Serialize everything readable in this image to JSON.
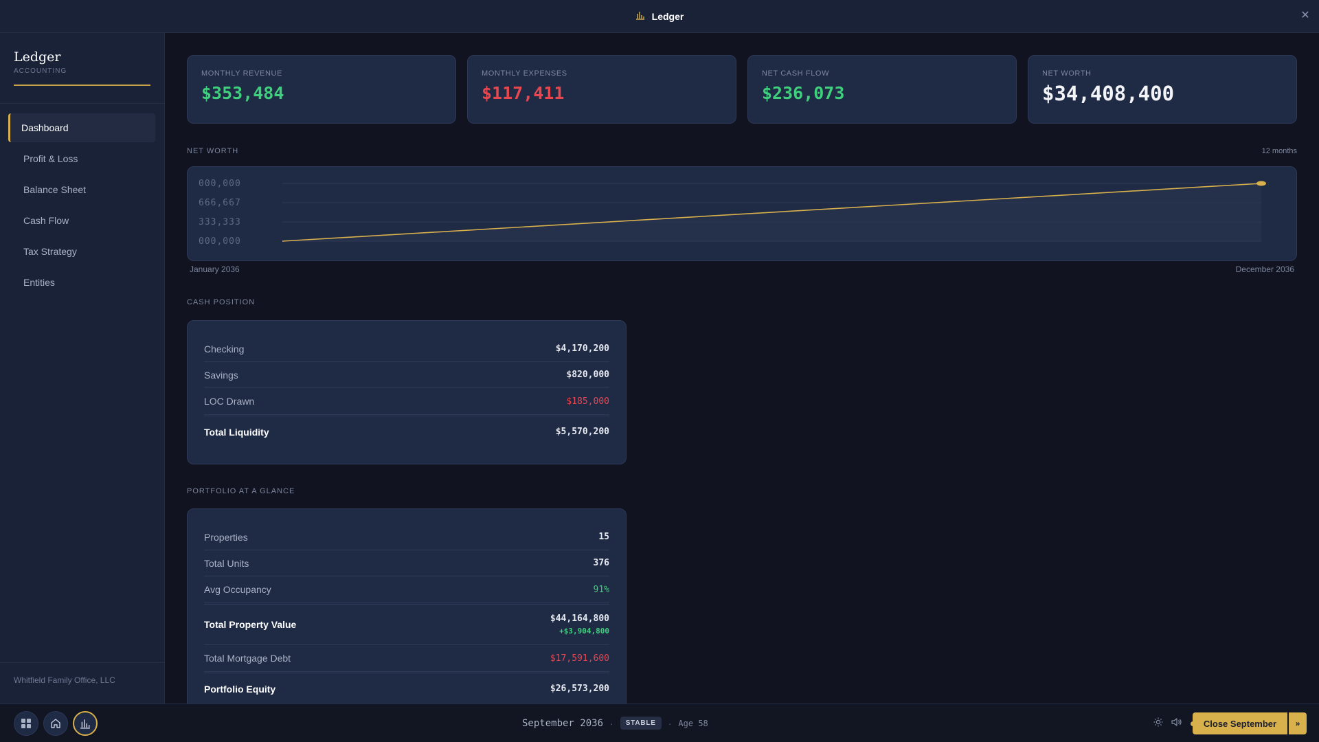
{
  "window": {
    "title": "Ledger",
    "close_glyph": "✕"
  },
  "sidebar": {
    "brand": "Ledger",
    "brand_sub": "ACCOUNTING",
    "items": [
      {
        "label": "Dashboard",
        "active": true
      },
      {
        "label": "Profit & Loss"
      },
      {
        "label": "Balance Sheet"
      },
      {
        "label": "Cash Flow"
      },
      {
        "label": "Tax Strategy"
      },
      {
        "label": "Entities"
      }
    ],
    "footer": "Whitfield Family Office, LLC"
  },
  "kpis": [
    {
      "label": "MONTHLY REVENUE",
      "value": "$353,484",
      "tone": "green"
    },
    {
      "label": "MONTHLY EXPENSES",
      "value": "$117,411",
      "tone": "red"
    },
    {
      "label": "NET CASH FLOW",
      "value": "$236,073",
      "tone": "green"
    },
    {
      "label": "NET WORTH",
      "value": "$34,408,400",
      "tone": "white"
    }
  ],
  "net_worth": {
    "label": "NET WORTH",
    "range_label": "12 months",
    "start_label": "January 2036",
    "end_label": "December 2036"
  },
  "chart_data": {
    "type": "area",
    "x": [
      "January 2036",
      "December 2036"
    ],
    "series": [
      {
        "values": [
          0,
          1000000
        ]
      }
    ],
    "y_ticks": [
      "000,000",
      "666,667",
      "333,333",
      "000,000"
    ],
    "ylim": [
      0,
      1000000
    ],
    "grid": true,
    "line_color": "#d9b14c"
  },
  "cash_position": {
    "label": "CASH POSITION",
    "rows": [
      {
        "label": "Checking",
        "value": "$4,170,200"
      },
      {
        "label": "Savings",
        "value": "$820,000"
      },
      {
        "label": "LOC Drawn",
        "value": "$185,000"
      }
    ],
    "total": {
      "label": "Total Liquidity",
      "value": "$5,570,200"
    }
  },
  "portfolio": {
    "label": "PORTFOLIO AT A GLANCE",
    "properties": {
      "label": "Properties",
      "value": "15"
    },
    "units": {
      "label": "Total Units",
      "value": "376"
    },
    "occupancy": {
      "label": "Avg Occupancy",
      "value": "91%"
    },
    "property_value": {
      "label": "Total Property Value",
      "value": "$44,164,800",
      "change": "+$3,904,800"
    },
    "mortgage": {
      "label": "Total Mortgage Debt",
      "value": "$17,591,600"
    },
    "equity": {
      "label": "Portfolio Equity",
      "value": "$26,573,200"
    }
  },
  "status": {
    "date": "September 2036",
    "badge": "STABLE",
    "age": "Age 58",
    "separator": "·"
  },
  "actions": {
    "close_month": "Close September",
    "more": "»"
  },
  "colors": {
    "accent": "#d9b14c",
    "positive": "#3fcf7d",
    "negative": "#e8474f"
  }
}
